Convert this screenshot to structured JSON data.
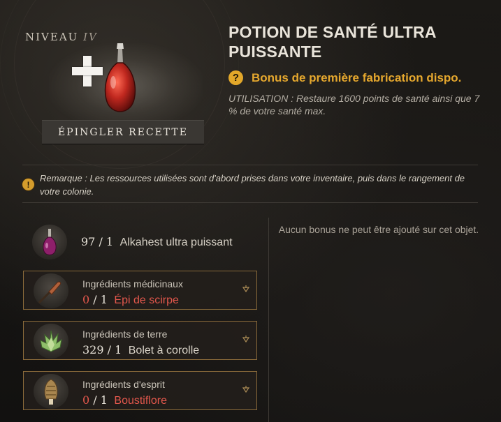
{
  "recipe": {
    "level_label": "NIVEAU",
    "level_value": "IV",
    "pin_button_label": "ÉPINGLER RECETTE",
    "title": "POTION DE SANTÉ ULTRA PUISSANTE",
    "bonus_text": "Bonus de première fabrication dispo.",
    "usage_text": "UTILISATION : Restaure 1600 points de santé ainsi que 7 % de votre santé max.",
    "note_text": "Remarque : Les ressources utilisées sont d'abord prises dans votre inventaire, puis dans le rangement de votre colonie."
  },
  "ingredients": [
    {
      "category": "",
      "owned": "97",
      "required": "1",
      "name": "Alkahest ultra puissant",
      "sufficient": true,
      "icon": "alkahest-flask-icon"
    },
    {
      "category": "Ingrédients médicinaux",
      "owned": "0",
      "required": "1",
      "name": "Épi de scirpe",
      "sufficient": false,
      "icon": "scirpe-icon"
    },
    {
      "category": "Ingrédients de terre",
      "owned": "329",
      "required": "1",
      "name": "Bolet à corolle",
      "sufficient": true,
      "icon": "bolet-icon"
    },
    {
      "category": "Ingrédients d'esprit",
      "owned": "0",
      "required": "1",
      "name": "Boustiflore",
      "sufficient": false,
      "icon": "boustiflore-icon"
    }
  ],
  "bonus_panel": {
    "text": "Aucun bonus ne peut être ajouté sur cet objet."
  },
  "colors": {
    "accent_gold": "#e6a82e",
    "missing_red": "#e2574c",
    "box_border": "#8a6a3a"
  }
}
